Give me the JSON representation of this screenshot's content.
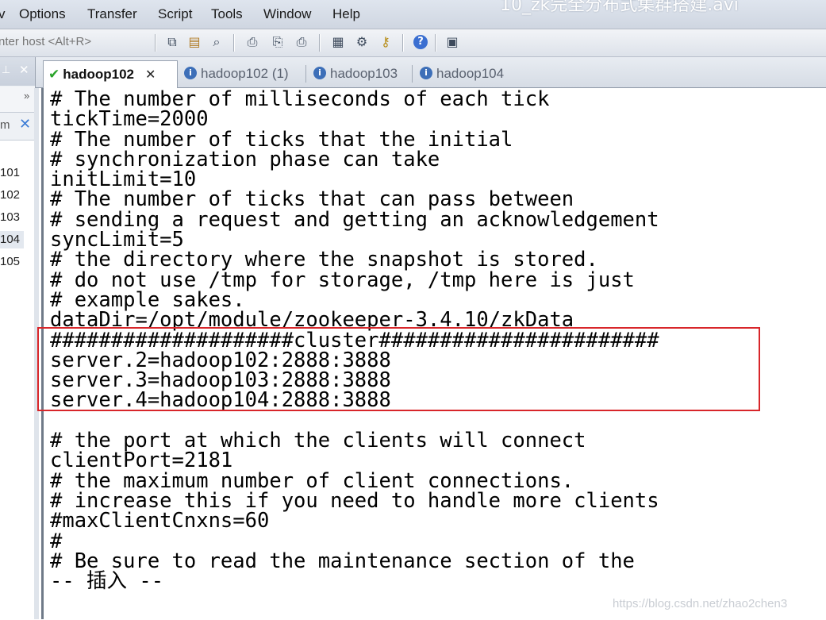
{
  "window": {
    "title": "10_zk完全分布式集群搭建.avi"
  },
  "menu": [
    "v",
    "Options",
    "Transfer",
    "Script",
    "Tools",
    "Window",
    "Help"
  ],
  "toolbar": {
    "host_placeholder": "nter host <Alt+R>",
    "icons": [
      "copy-icon",
      "paste-icon",
      "find-icon",
      "print-setup-icon",
      "print-selection-icon",
      "print-icon",
      "session-options-icon",
      "global-options-icon",
      "key-icon",
      "help-icon",
      "screen-icon"
    ]
  },
  "left_panel": {
    "filter_text": "m",
    "sessions": [
      "101",
      "102",
      "103",
      "104",
      "105"
    ],
    "selected": "104"
  },
  "tabs": [
    {
      "label": "hadoop102",
      "active": true,
      "status": "connected"
    },
    {
      "label": "hadoop102 (1)",
      "active": false,
      "status": "info"
    },
    {
      "label": "hadoop103",
      "active": false,
      "status": "info"
    },
    {
      "label": "hadoop104",
      "active": false,
      "status": "info"
    }
  ],
  "terminal": {
    "lines": [
      "# The number of milliseconds of each tick",
      "tickTime=2000",
      "# The number of ticks that the initial",
      "# synchronization phase can take",
      "initLimit=10",
      "# The number of ticks that can pass between",
      "# sending a request and getting an acknowledgement",
      "syncLimit=5",
      "# the directory where the snapshot is stored.",
      "# do not use /tmp for storage, /tmp here is just",
      "# example sakes.",
      "dataDir=/opt/module/zookeeper-3.4.10/zkData",
      "####################cluster#######################",
      "server.2=hadoop102:2888:3888",
      "server.3=hadoop103:2888:3888",
      "server.4=hadoop104:2888:3888",
      "",
      "# the port at which the clients will connect",
      "clientPort=2181",
      "# the maximum number of client connections.",
      "# increase this if you need to handle more clients",
      "#maxClientCnxns=60",
      "#",
      "# Be sure to read the maintenance section of the",
      "-- 插入 --"
    ],
    "highlight_color": "#d8262a"
  },
  "watermark": "https://blog.csdn.net/zhao2chen3"
}
